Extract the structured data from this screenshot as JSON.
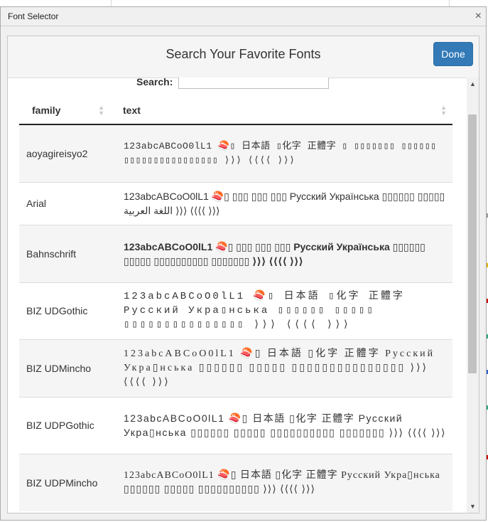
{
  "window": {
    "title": "Font Selector",
    "close_glyph": "×"
  },
  "header": {
    "title": "Search Your Favorite Fonts",
    "done_label": "Done"
  },
  "search": {
    "label": "Search:",
    "value": "",
    "placeholder": ""
  },
  "table": {
    "columns": [
      "family",
      "text"
    ],
    "rows": [
      {
        "family": "aoyagireisyo2",
        "text": "123abcABCoO0lL1 🍣▯ 日本語 ▯化字 正體字 ▯ ▯▯▯▯▯▯▯ ▯▯▯▯▯▯ ▯▯▯▯▯▯▯▯▯▯▯▯▯▯▯▯ ⟩⟩⟩ ⟨⟨⟨⟨ ⟩⟩⟩"
      },
      {
        "family": "Arial",
        "text": "123abcABCoO0lL1 🍣▯ ▯▯▯ ▯▯▯ ▯▯▯ Русский Українська ▯▯▯▯▯▯ ▯▯▯▯▯ اللغة العربية ⟩⟩⟩ ⟨⟨⟨⟨ ⟩⟩⟩"
      },
      {
        "family": "Bahnschrift",
        "text": "123abcABCoO0lL1 🍣▯ ▯▯▯ ▯▯▯ ▯▯▯ Русский Українська ▯▯▯▯▯▯ ▯▯▯▯▯ ▯▯▯▯▯▯▯▯▯▯ ▯▯▯▯▯▯▯ ⟩⟩⟩ ⟨⟨⟨⟨ ⟩⟩⟩"
      },
      {
        "family": "BIZ UDGothic",
        "text": "123abcABCoO0lL1 🍣▯ 日本語 ▯化字 正體字 Русский Укра▯нська ▯▯▯▯▯▯ ▯▯▯▯▯ ▯▯▯▯▯▯▯▯▯▯▯▯▯▯▯ ⟩⟩⟩ ⟨⟨⟨⟨ ⟩⟩⟩"
      },
      {
        "family": "BIZ UDMincho",
        "text": "123abcABCoO0lL1 🍣▯ 日本語 ▯化字 正體字 Русский Укра▯нська ▯▯▯▯▯▯ ▯▯▯▯▯ ▯▯▯▯▯▯▯▯▯▯▯▯▯▯▯ ⟩⟩⟩ ⟨⟨⟨⟨ ⟩⟩⟩"
      },
      {
        "family": "BIZ UDPGothic",
        "text": "123abcABCoO0lL1 🍣▯ 日本語 ▯化字 正體字 Русский Укра▯нська ▯▯▯▯▯▯ ▯▯▯▯▯ ▯▯▯▯▯▯▯▯▯▯ ▯▯▯▯▯▯▯ ⟩⟩⟩ ⟨⟨⟨⟨ ⟩⟩⟩"
      },
      {
        "family": "BIZ UDPMincho",
        "text": "123abcABCoO0lL1 🍣▯ 日本語 ▯化字 正體字 Русский Укра▯нська ▯▯▯▯▯▯ ▯▯▯▯▯ ▯▯▯▯▯▯▯▯▯▯ ⟩⟩⟩ ⟨⟨⟨⟨ ⟩⟩⟩"
      }
    ]
  },
  "icons": {
    "sort": "sort-icon",
    "close": "close-icon",
    "scroll_up": "scroll-up-arrow-icon",
    "scroll_down": "scroll-down-arrow-icon"
  },
  "colors": {
    "done_button": "#337ab7",
    "header_bg": "#f5f5f5",
    "row_alt": "#f5f5f5"
  },
  "scrollbar": {
    "glyph_up": "▲",
    "glyph_down": "▼"
  }
}
